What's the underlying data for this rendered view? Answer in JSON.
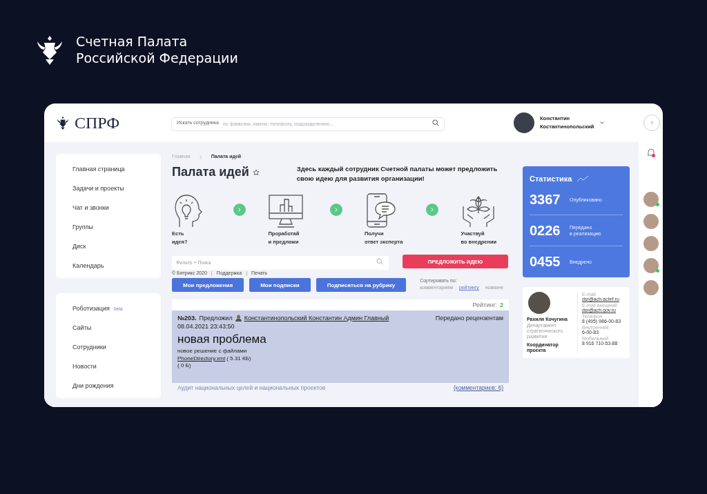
{
  "brand": {
    "title": "Счетная Палата\nРоссийской Федерации"
  },
  "header": {
    "logo": "СПРФ",
    "search_label": "Искать сотрудника",
    "search_placeholder": "по фамилии, имени, телефону, подразделению...",
    "user_name": "Константин\nКостантинопольский",
    "help": "?"
  },
  "sidebar": {
    "groups": [
      [
        {
          "label": "Главная страница"
        },
        {
          "label": "Задачи и проекты"
        },
        {
          "label": "Чат и звонки"
        },
        {
          "label": "Группы"
        },
        {
          "label": "Диск"
        },
        {
          "label": "Календарь"
        }
      ],
      [
        {
          "label": "Роботизация",
          "badge": "beta"
        },
        {
          "label": "Сайты"
        },
        {
          "label": "Сотрудники"
        },
        {
          "label": "Новости"
        },
        {
          "label": "Дни рождения"
        }
      ]
    ]
  },
  "breadcrumbs": [
    "Главная",
    "Палата идей"
  ],
  "page_title": "Палата идей",
  "intro": "Здесь каждый сотрудник Счетной палаты может предложить свою идею для развития организации!",
  "steps": [
    {
      "kind": "head",
      "label": "Есть\nидея?"
    },
    {
      "kind": "monitor",
      "label": "Проработай\nи предложи"
    },
    {
      "kind": "phone",
      "label": "Получи\nответ эксперта"
    },
    {
      "kind": "hands",
      "label": "Участвуй\nво внедрении"
    }
  ],
  "filter": {
    "placeholder": "Фильтр + Поиск"
  },
  "propose_button": "ПРЕДЛОЖИТЬ ИДЕЮ",
  "footer_links": [
    "© Битрикс 2020",
    "Поддержка",
    "Печать"
  ],
  "footer_separator": "|",
  "action_buttons": [
    "Мои предложения",
    "Мои подписки",
    "Подписаться на рубрику"
  ],
  "sort": {
    "label": "Сортировать по:",
    "options": [
      {
        "label": "комментариям",
        "selected": false
      },
      {
        "label": "рейтингу",
        "selected": true
      },
      {
        "label": "новизне",
        "selected": false
      }
    ]
  },
  "idea": {
    "rating_label": "Рейтинг:",
    "rating": "2",
    "number": "№203.",
    "proposed": "Предложил",
    "author": "Константинопольский Константин Админ Главный",
    "status": "Передано рецензентам",
    "date": "08.04.2021 23:43:50",
    "title": "новая проблема",
    "description": "новое решение с файлами",
    "file": "PhoneDirectory.xml",
    "file_size": "( 5.31 КБ)",
    "extra_size": "( 0 Б)",
    "category": "Аудит национальных целей и национальных проектов",
    "comments": "(комментариев: 6)"
  },
  "stats": {
    "title": "Статистика",
    "items": [
      {
        "value": "3367",
        "label": "Опубликовано"
      },
      {
        "value": "0226",
        "label": "Передано\nв реализацию"
      },
      {
        "value": "0455",
        "label": "Внедрено"
      }
    ]
  },
  "contact": {
    "name": "Рахиля Кочугина",
    "department": "Департамент стратегического развития",
    "role": "Координатор проекта",
    "fields": [
      {
        "label": "E-mail",
        "value": "dsr@ach.achrf.ru",
        "link": true
      },
      {
        "label": "E-mail внешний",
        "value": "dsr@ach.gov.ru",
        "link": true
      },
      {
        "label": "Телефон",
        "value": "8 (495) 986-00-83",
        "link": false
      },
      {
        "label": "Внутренний",
        "value": "6-00-83",
        "link": false
      },
      {
        "label": "Мобильный",
        "value": "8 916 710-53-88",
        "link": false
      }
    ]
  },
  "rail": {
    "avatars": [
      {
        "online": true
      },
      {
        "online": false
      },
      {
        "online": false
      },
      {
        "online": true
      },
      {
        "online": false
      }
    ]
  }
}
